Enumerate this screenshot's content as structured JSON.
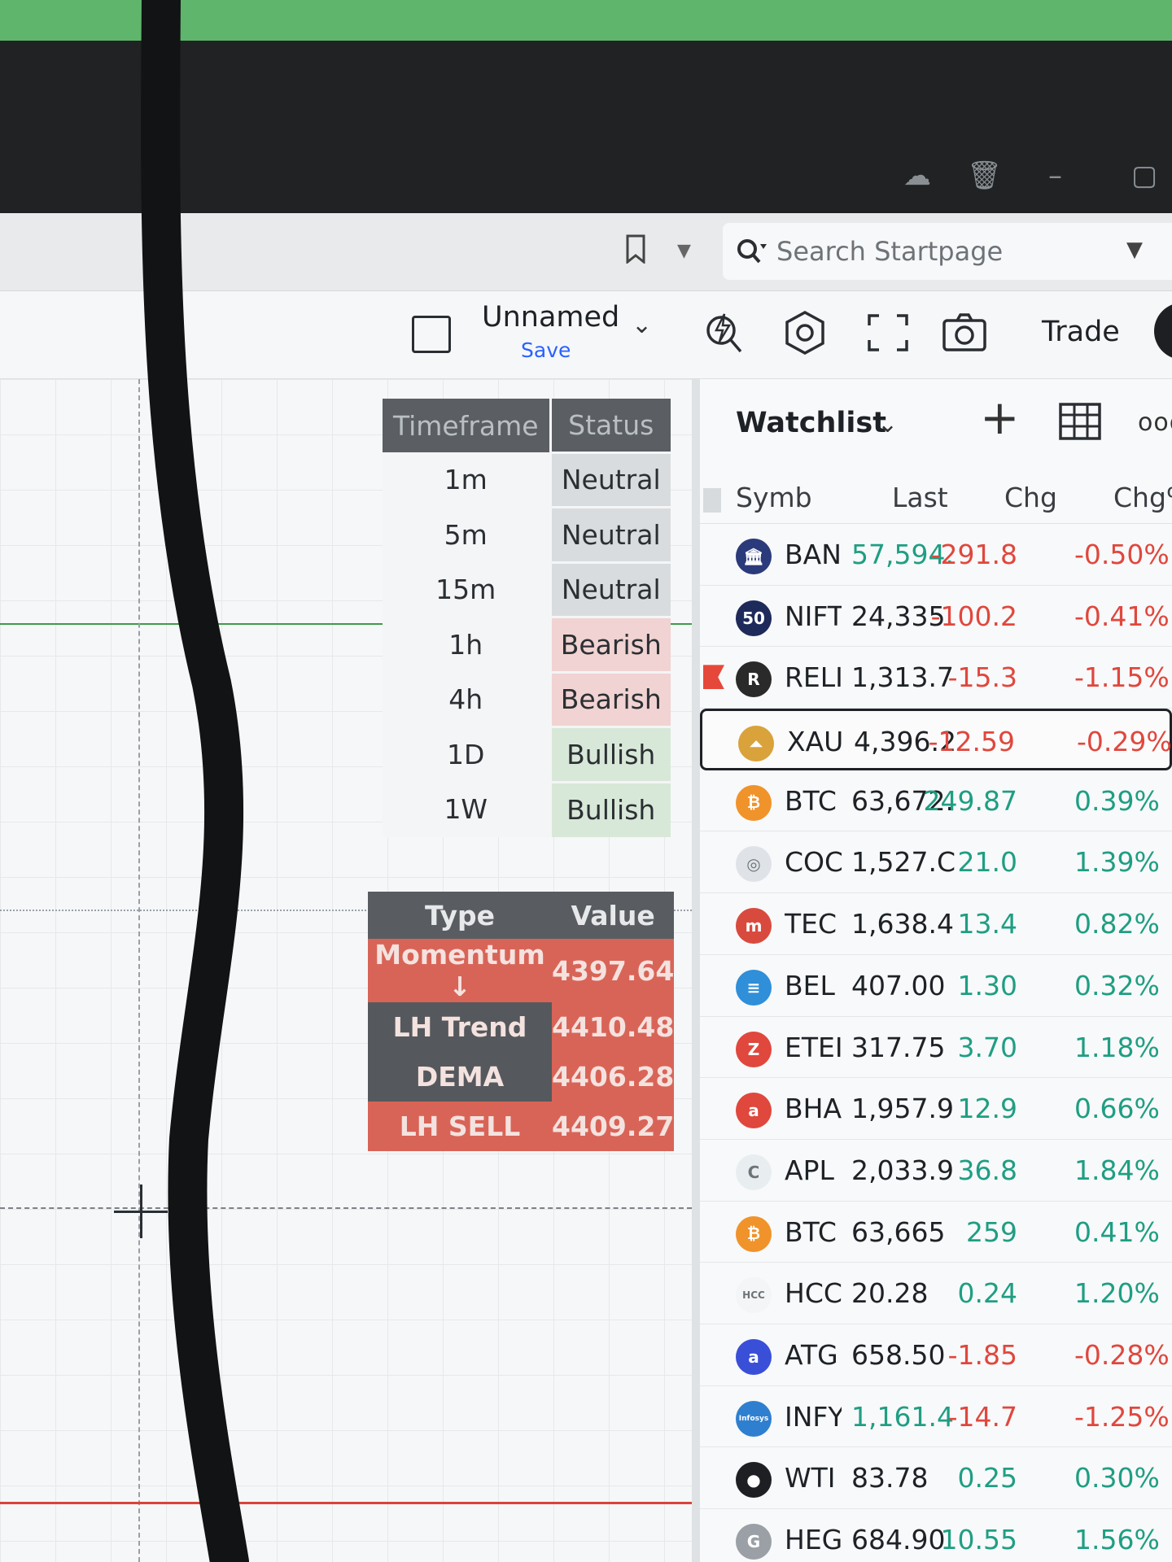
{
  "browser": {
    "search_placeholder": "Search Startpage"
  },
  "toolbar": {
    "layout_name": "Unnamed",
    "save_label": "Save",
    "trade_label": "Trade"
  },
  "signal_table": {
    "headers": [
      "Timeframe",
      "Status"
    ],
    "rows": [
      {
        "timeframe": "1m",
        "status": "Neutral"
      },
      {
        "timeframe": "5m",
        "status": "Neutral"
      },
      {
        "timeframe": "15m",
        "status": "Neutral"
      },
      {
        "timeframe": "1h",
        "status": "Bearish"
      },
      {
        "timeframe": "4h",
        "status": "Bearish"
      },
      {
        "timeframe": "1D",
        "status": "Bullish"
      },
      {
        "timeframe": "1W",
        "status": "Bullish"
      }
    ],
    "status_colors": {
      "Neutral": "#d9dcde",
      "Bearish": "#f0d3d2",
      "Bullish": "#d8e8d8"
    }
  },
  "value_table": {
    "headers": [
      "Type",
      "Value"
    ],
    "rows": [
      {
        "type": "Momentum ↓",
        "value": "4397.64"
      },
      {
        "type": "LH Trend",
        "value": "4410.48"
      },
      {
        "type": "DEMA",
        "value": "4406.28"
      },
      {
        "type": "LH SELL",
        "value": "4409.27"
      }
    ]
  },
  "watchlist": {
    "title": "Watchlist",
    "columns": [
      "Symb",
      "Last",
      "Chg",
      "Chg%"
    ],
    "rows": [
      {
        "symbol": "BAN",
        "last": "57,594.",
        "chg": "-291.8",
        "chgp": "-0.50%",
        "dir": "neg",
        "last_dir": "pos",
        "logo": "bank-icon",
        "logo_color": "#2a3a7a",
        "logo_text": "🏛"
      },
      {
        "symbol": "NIFT",
        "last": "24,335.",
        "chg": "-100.2",
        "chgp": "-0.41%",
        "dir": "neg",
        "logo": "nifty-icon",
        "logo_color": "#1e2a5a",
        "logo_text": "50"
      },
      {
        "symbol": "RELI",
        "last": "1,313.7",
        "chg": "-15.3",
        "chgp": "-1.15%",
        "dir": "neg",
        "logo": "reliance-icon",
        "logo_color": "#2a2a2a",
        "logo_text": "R",
        "flag": true
      },
      {
        "symbol": "XAU",
        "last": "4,396.2",
        "chg": "-12.59",
        "chgp": "-0.29%",
        "dir": "neg",
        "logo": "gold-icon",
        "logo_color": "#d9a23a",
        "logo_text": "⏶",
        "selected": true
      },
      {
        "symbol": "BTC",
        "last": "63,672.",
        "chg": "249.87",
        "chgp": "0.39%",
        "dir": "pos",
        "logo": "bitcoin-icon",
        "logo_color": "#f0932b",
        "logo_text": "₿"
      },
      {
        "symbol": "COC",
        "last": "1,527.C",
        "chg": "21.0",
        "chgp": "1.39%",
        "dir": "pos",
        "logo": "coin-icon",
        "logo_color": "#dfe3e8",
        "logo_text": "◎"
      },
      {
        "symbol": "TEC",
        "last": "1,638.4",
        "chg": "13.4",
        "chgp": "0.82%",
        "dir": "pos",
        "logo": "tech-icon",
        "logo_color": "#d94a3e",
        "logo_text": "m"
      },
      {
        "symbol": "BEL",
        "last": "407.00",
        "chg": "1.30",
        "chgp": "0.32%",
        "dir": "pos",
        "logo": "bel-icon",
        "logo_color": "#2f8fd8",
        "logo_text": "≡"
      },
      {
        "symbol": "ETEI",
        "last": "317.75",
        "chg": "3.70",
        "chgp": "1.18%",
        "dir": "pos",
        "logo": "eternal-icon",
        "logo_color": "#e0473d",
        "logo_text": "Z"
      },
      {
        "symbol": "BHA",
        "last": "1,957.9",
        "chg": "12.9",
        "chgp": "0.66%",
        "dir": "pos",
        "logo": "airtel-icon",
        "logo_color": "#e0473d",
        "logo_text": "a"
      },
      {
        "symbol": "APL",
        "last": "2,033.9",
        "chg": "36.8",
        "chgp": "1.84%",
        "dir": "pos",
        "logo": "apollo-icon",
        "logo_color": "#e8eef0",
        "logo_text": "C"
      },
      {
        "symbol": "BTC",
        "last": "63,665",
        "chg": "259",
        "chgp": "0.41%",
        "dir": "pos",
        "logo": "bitcoin-icon",
        "logo_color": "#f0932b",
        "logo_text": "₿"
      },
      {
        "symbol": "HCC",
        "last": "20.28",
        "chg": "0.24",
        "chgp": "1.20%",
        "dir": "pos",
        "logo": "hcc-icon",
        "logo_color": "#f4f5f6",
        "logo_text": "HCC"
      },
      {
        "symbol": "ATG",
        "last": "658.50",
        "chg": "-1.85",
        "chgp": "-0.28%",
        "dir": "neg",
        "logo": "atg-icon",
        "logo_color": "#3a4fd8",
        "logo_text": "a"
      },
      {
        "symbol": "INFY",
        "last": "1,161.4",
        "chg": "-14.7",
        "chgp": "-1.25%",
        "dir": "neg",
        "last_dir": "pos",
        "logo": "infosys-icon",
        "logo_color": "#2f7fd0",
        "logo_text": "Infosys"
      },
      {
        "symbol": "WTI",
        "last": "83.78",
        "chg": "0.25",
        "chgp": "0.30%",
        "dir": "pos",
        "logo": "oil-icon",
        "logo_color": "#1e1f22",
        "logo_text": "●"
      },
      {
        "symbol": "HEG",
        "last": "684.90",
        "chg": "10.55",
        "chgp": "1.56%",
        "dir": "pos",
        "logo": "heg-icon",
        "logo_color": "#9aa0a6",
        "logo_text": "G"
      }
    ]
  }
}
